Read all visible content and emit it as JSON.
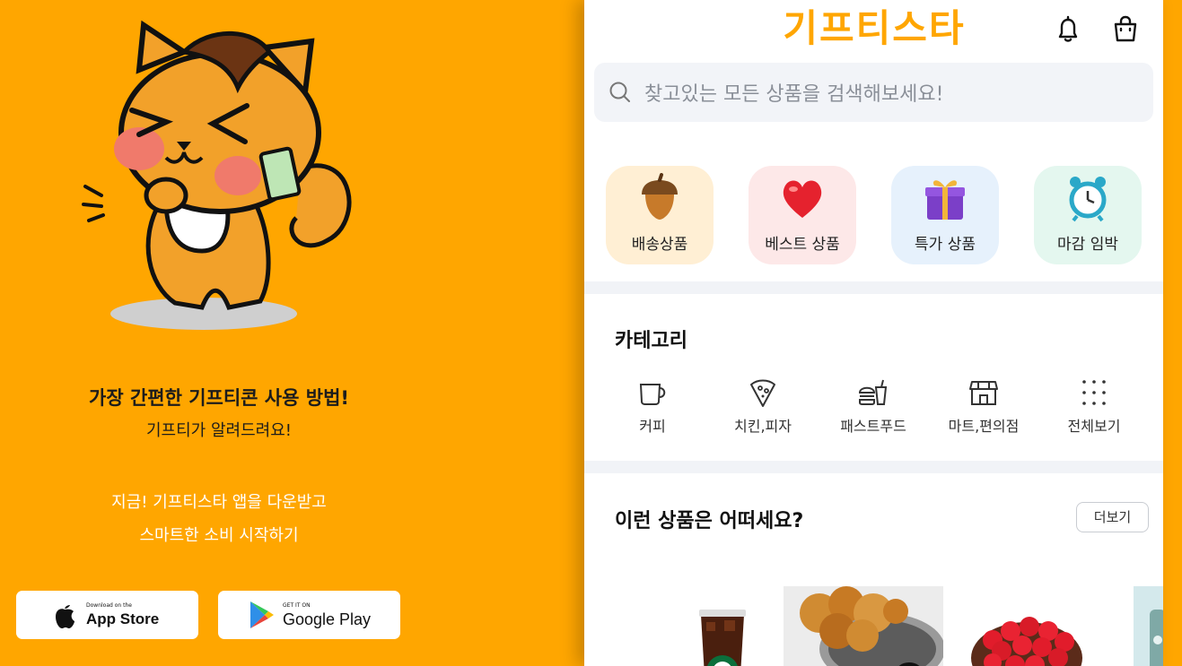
{
  "promo": {
    "heading": "가장 간편한 기프티콘 사용 방법!",
    "subheading": "기프티가 알려드려요!",
    "cta_line1": "지금! 기프티스타 앱을 다운받고",
    "cta_line2": "스마트한 소비 시작하기",
    "app_store": {
      "small": "Download on the",
      "big": "App Store"
    },
    "google_play": {
      "small": "GET IT ON",
      "big": "Google Play"
    }
  },
  "header": {
    "logo": "기프티스타",
    "icons": [
      "bell-icon",
      "shopping-bag-icon"
    ]
  },
  "search": {
    "placeholder": "찾고있는 모든 상품을 검색해보세요!"
  },
  "quick_menu": [
    {
      "label": "배송상품",
      "icon": "acorn-icon"
    },
    {
      "label": "베스트 상품",
      "icon": "heart-icon"
    },
    {
      "label": "특가 상품",
      "icon": "gift-box-icon"
    },
    {
      "label": "마감 임박",
      "icon": "alarm-clock-icon"
    }
  ],
  "category": {
    "title": "카테고리",
    "items": [
      {
        "label": "커피",
        "icon": "coffee-cup-icon"
      },
      {
        "label": "치킨,피자",
        "icon": "pizza-icon"
      },
      {
        "label": "패스트푸드",
        "icon": "burger-drink-icon"
      },
      {
        "label": "마트,편의점",
        "icon": "store-icon"
      },
      {
        "label": "전체보기",
        "icon": "grid-dots-icon"
      }
    ]
  },
  "recommend": {
    "title": "이런 상품은 어떠세요?",
    "more_label": "더보기",
    "products": [
      "iced-coffee-image",
      "fried-chicken-image",
      "strawberry-cake-image",
      "product-image"
    ]
  },
  "colors": {
    "brand": "#FFA600",
    "accent_text": "#ffffff"
  }
}
